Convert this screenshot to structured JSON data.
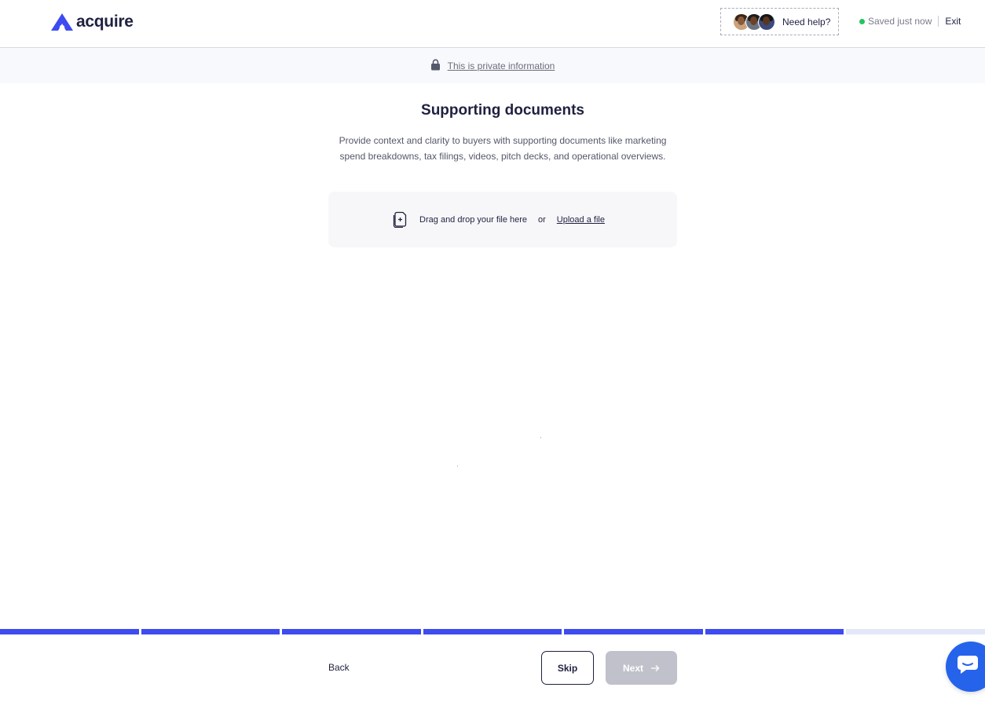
{
  "header": {
    "logo_text": "acquire",
    "help_label": "Need help?",
    "save_status": "Saved just now",
    "exit_label": "Exit"
  },
  "banner": {
    "private_label": "This is private information"
  },
  "main": {
    "title": "Supporting documents",
    "description": "Provide context and clarity to buyers with supporting documents like marketing spend breakdowns, tax filings, videos, pitch decks, and operational overviews.",
    "dropzone": {
      "drag_text": "Drag and drop your file here",
      "or_text": "or",
      "upload_label": "Upload a file"
    }
  },
  "progress": {
    "completed_steps": 6,
    "total_steps": 7
  },
  "footer": {
    "back_label": "Back",
    "skip_label": "Skip",
    "next_label": "Next"
  },
  "colors": {
    "accent": "#3d4bf0",
    "status_green": "#22c55e",
    "chat_blue": "#2563eb",
    "next_disabled": "#c1c1cb"
  },
  "icons": [
    "acquire-logo-icon",
    "avatar",
    "lock-icon",
    "file-icon",
    "arrow-right-icon",
    "chat-icon"
  ]
}
